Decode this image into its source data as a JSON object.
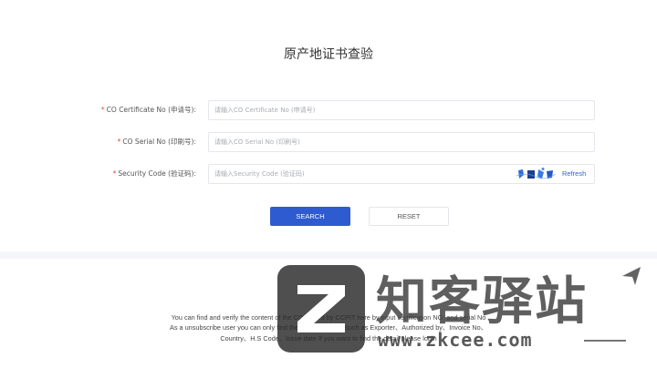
{
  "page": {
    "title": "原产地证书查验"
  },
  "form": {
    "co_certificate": {
      "label": "CO Certificate No (申请号):",
      "placeholder": "请输入CO Certificate No (申请号)"
    },
    "co_serial": {
      "label": "CO Serial No (印刷号):",
      "placeholder": "请输入CO Serial No (印刷号)"
    },
    "security_code": {
      "label": "Security Code (验证码):",
      "placeholder": "请输入Security Code (验证码)",
      "refresh": "Refresh"
    },
    "required_mark": "*"
  },
  "buttons": {
    "search": "SEARCH",
    "reset": "RESET"
  },
  "footer": {
    "line1": "You can find and verify the content of the CO issued by CCPIT here by input certification NO. and serial No",
    "line2": "As a unsubscribe user you can only find the limited content such as Exporter、Authorized by、Invoice No、",
    "line3": "Country、H.S Code、Issue date If you want to find the detail please login"
  },
  "watermark": {
    "brand": "知客驿站",
    "url": "www.zkcee.com"
  },
  "colors": {
    "primary": "#2f5bd1",
    "required": "#e34b3c",
    "link": "#2f62d6"
  }
}
